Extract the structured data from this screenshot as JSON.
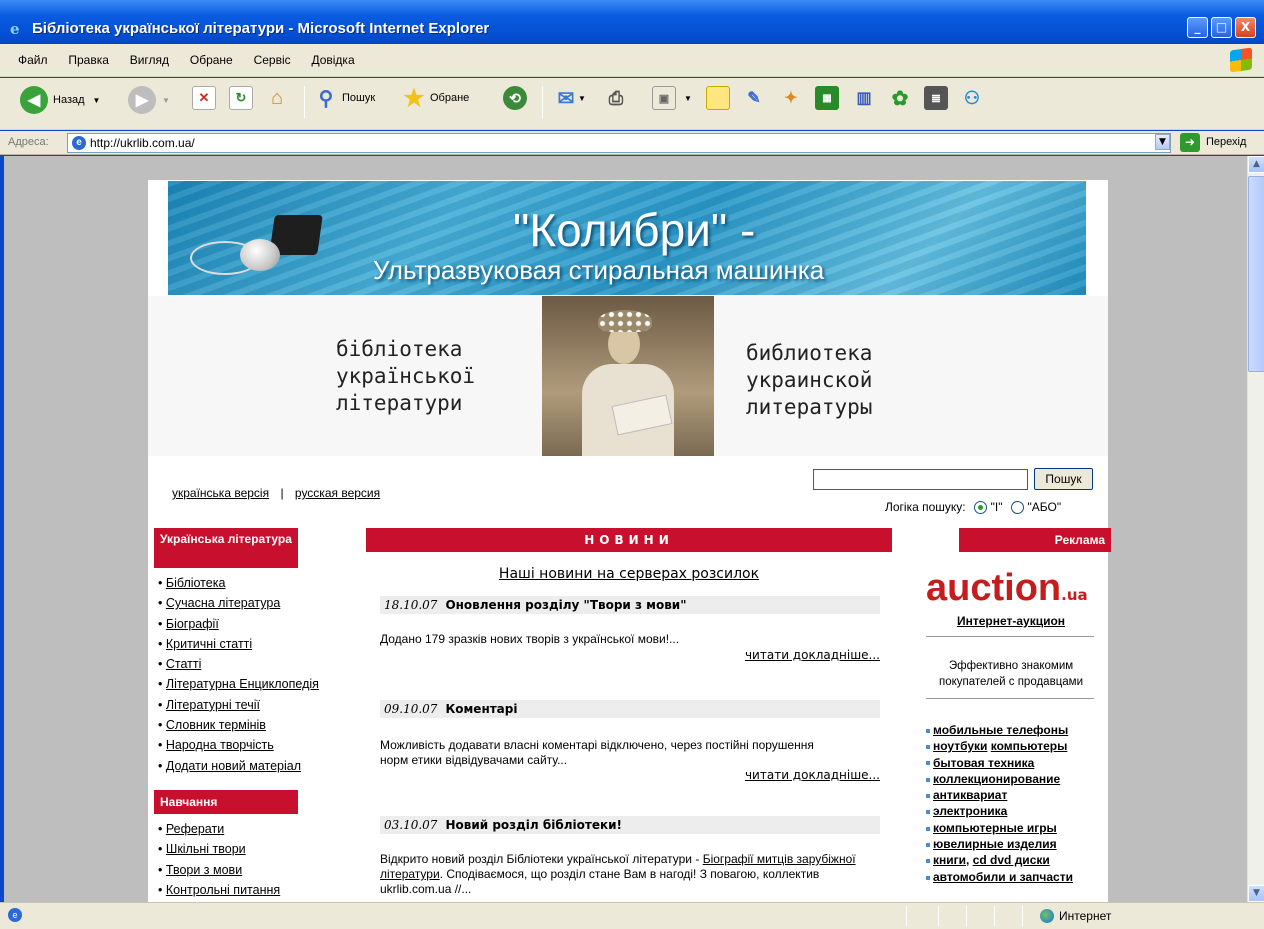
{
  "window": {
    "title": "Бібліотека української літератури - Microsoft Internet Explorer",
    "min": "_",
    "max": "□",
    "close": "X"
  },
  "menu": [
    "Файл",
    "Правка",
    "Вигляд",
    "Обране",
    "Сервіс",
    "Довідка"
  ],
  "toolbar": {
    "back": "Назад",
    "search": "Пошук",
    "favorites": "Обране"
  },
  "address": {
    "label": "Адреса:",
    "url": "http://ukrlib.com.ua/",
    "go": "Перехід"
  },
  "banner": {
    "title": "\"Колибри\" -",
    "subtitle": "Ультразвуковая стиральная машинка"
  },
  "logo": {
    "ua": "бібліотека\nукраїнської\nлітератури",
    "ru": "библиотека\nукраинской\nлитературы"
  },
  "lang": {
    "ua": "українська версія",
    "sep": "|",
    "ru": "русская версия"
  },
  "search": {
    "button": "Пошук",
    "logic_label": "Логіка пошуку:",
    "opt_and": "\"І\"",
    "opt_or": "\"АБО\"",
    "selected": "\"І\""
  },
  "sidebar": {
    "section1": "Українська література",
    "items1": [
      "Бібліотека",
      "Сучасна література",
      "Біографії",
      "Критичні статті",
      "Статті",
      "Літературна Енциклопедія",
      "Літературні течії",
      "Словник термінів",
      "Народна творчість",
      "Додати новий матеріал"
    ],
    "section2": "Навчання",
    "items2": [
      "Реферати",
      "Шкільні твори",
      "Твори з мови",
      "Контрольні питання"
    ]
  },
  "news": {
    "header": "НОВИНИ",
    "subheader": "Наші новини на серверах розсилок",
    "items": [
      {
        "date": "18.10.07",
        "title": "Оновлення розділу \"Твори з мови\"",
        "text": "Додано 179 зразків нових творів з української мови!...",
        "more": "читати докладніше..."
      },
      {
        "date": "09.10.07",
        "title": "Коментарі",
        "text": "Можливість додавати власні коментарі відключено, через постійні порушення норм етики відвідувачами сайту...",
        "more": "читати докладніше..."
      },
      {
        "date": "03.10.07",
        "title": "Новий розділ бібліотеки!",
        "text_pre": "Відкрито новий розділ Бібліотеки української літератури - ",
        "text_link": "Біографії митців зарубіжної літератури",
        "text_post": ". Сподіваємося, що розділ стане Вам в нагоді! З повагою, коллектив ukrlib.com.ua //..."
      }
    ]
  },
  "ads": {
    "header": "Реклама",
    "logo_main": "auction",
    "logo_suffix": ".ua",
    "name": "Интернет-аукцион",
    "desc": "Эффективно знакомим покупателей с продавцами",
    "categories": [
      [
        "мобильные телефоны"
      ],
      [
        "ноутбуки",
        "компьютеры"
      ],
      [
        "бытовая техника"
      ],
      [
        "коллекционирование"
      ],
      [
        "антиквариат"
      ],
      [
        "электроника"
      ],
      [
        "компьютерные игры"
      ],
      [
        "ювелирные изделия"
      ],
      [
        "книги",
        "cd dvd диски"
      ],
      [
        "автомобили и запчасти"
      ]
    ]
  },
  "status": {
    "zone": "Интернет"
  },
  "colors": {
    "accent_red": "#c8102e",
    "xp_blue": "#0552d6",
    "chrome": "#ece9d8"
  }
}
